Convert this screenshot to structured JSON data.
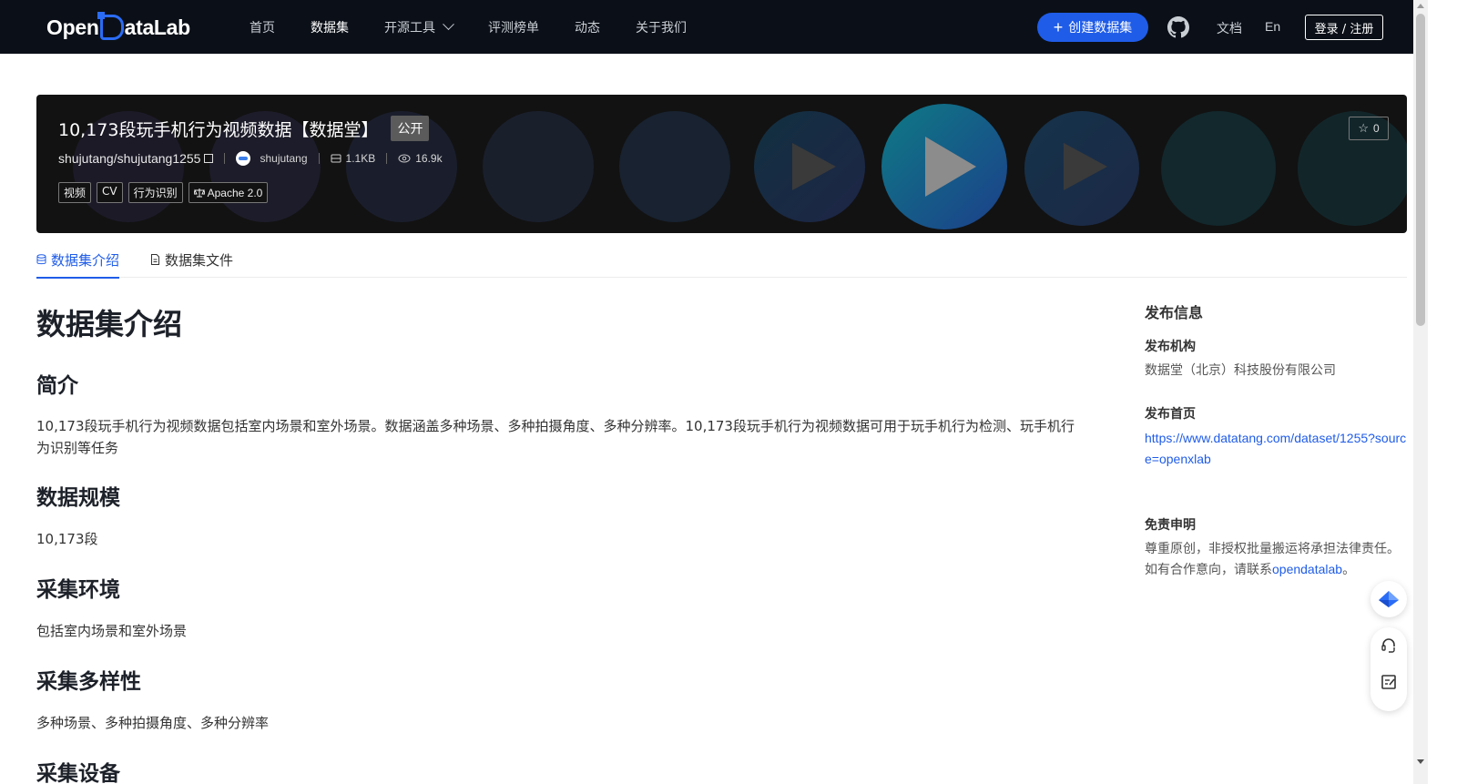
{
  "nav": {
    "logo": "OpenDataLab",
    "logo_left": "Open",
    "logo_right": "ataLab",
    "items": [
      "首页",
      "数据集",
      "开源工具",
      "评测榜单",
      "动态",
      "关于我们"
    ],
    "active_item": "数据集",
    "create_label": "创建数据集",
    "docs_label": "文档",
    "lang_label": "En",
    "login_label": "登录 / 注册"
  },
  "dataset": {
    "title": "10,173段玩手机行为视频数据【数据堂】",
    "visibility": "公开",
    "repo": "shujutang/shujutang1255",
    "owner": "shujutang",
    "size": "1.1KB",
    "views": "16.9k",
    "tags": [
      "视频",
      "CV",
      "行为识别"
    ],
    "license": "Apache 2.0",
    "stars": "0"
  },
  "tabs": [
    "数据集介绍",
    "数据集文件"
  ],
  "content": {
    "heading": "数据集介绍",
    "sections": [
      {
        "title": "简介",
        "text": "10,173段玩手机行为视频数据包括室内场景和室外场景。数据涵盖多种场景、多种拍摄角度、多种分辨率。10,173段玩手机行为视频数据可用于玩手机行为检测、玩手机行为识别等任务"
      },
      {
        "title": "数据规模",
        "text": "10,173段"
      },
      {
        "title": "采集环境",
        "text": "包括室内场景和室外场景"
      },
      {
        "title": "采集多样性",
        "text": "多种场景、多种拍摄角度、多种分辨率"
      },
      {
        "title": "采集设备",
        "text": ""
      }
    ]
  },
  "sidebar": {
    "title": "发布信息",
    "publisher_label": "发布机构",
    "publisher": "数据堂（北京）科技股份有限公司",
    "homepage_label": "发布首页",
    "homepage": "https://www.datatang.com/dataset/1255?source=openxlab",
    "disclaimer_label": "免责申明",
    "disclaimer_text": "尊重原创，非授权批量搬运将承担法律责任。如有合作意向，请联系",
    "disclaimer_link": "opendatalab",
    "disclaimer_end": "。"
  },
  "colors": {
    "nav_bg": "#0b1018",
    "accent": "#1f5ce8",
    "hero_bg": "#121212"
  }
}
